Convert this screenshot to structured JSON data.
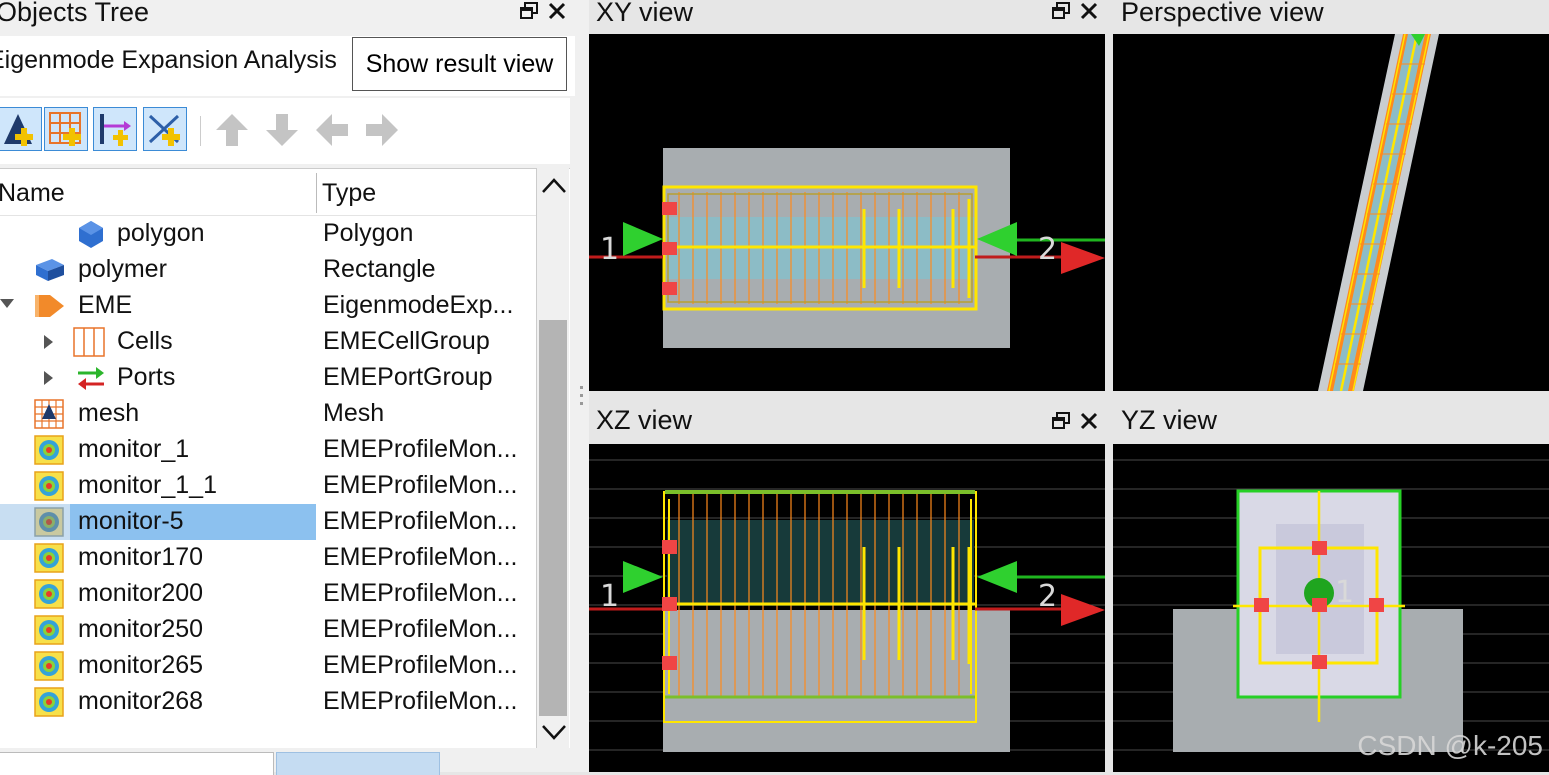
{
  "left_panel": {
    "title": "Objects Tree",
    "analysis_label": "Eigenmode Expansion Analysis",
    "show_result_button": "Show result view",
    "toolbar": {
      "buttons": [
        "add-structure-icon",
        "add-mesh-icon",
        "add-port-icon",
        "add-monitor-icon"
      ],
      "arrows": [
        "arrow-up-icon",
        "arrow-down-icon",
        "arrow-left-icon",
        "arrow-right-icon"
      ]
    },
    "columns": {
      "name": "Name",
      "type": "Type"
    },
    "rows": [
      {
        "name": "polygon",
        "type": "Polygon",
        "icon": "polygon-icon"
      },
      {
        "name": "polymer",
        "type": "Rectangle",
        "icon": "rectangle-icon"
      },
      {
        "name": "EME",
        "type": "EigenmodeExp...",
        "icon": "eme-solver-icon"
      },
      {
        "name": "Cells",
        "type": "EMECellGroup",
        "icon": "cells-icon"
      },
      {
        "name": "Ports",
        "type": "EMEPortGroup",
        "icon": "ports-icon"
      },
      {
        "name": "mesh",
        "type": "Mesh",
        "icon": "mesh-icon"
      },
      {
        "name": "monitor_1",
        "type": "EMEProfileMon...",
        "icon": "monitor-icon"
      },
      {
        "name": "monitor_1_1",
        "type": "EMEProfileMon...",
        "icon": "monitor-icon"
      },
      {
        "name": "monitor-5",
        "type": "EMEProfileMon...",
        "icon": "monitor-icon",
        "selected": true
      },
      {
        "name": "monitor170",
        "type": "EMEProfileMon...",
        "icon": "monitor-icon"
      },
      {
        "name": "monitor200",
        "type": "EMEProfileMon...",
        "icon": "monitor-icon"
      },
      {
        "name": "monitor250",
        "type": "EMEProfileMon...",
        "icon": "monitor-icon"
      },
      {
        "name": "monitor265",
        "type": "EMEProfileMon...",
        "icon": "monitor-icon"
      },
      {
        "name": "monitor268",
        "type": "EMEProfileMon...",
        "icon": "monitor-icon"
      }
    ]
  },
  "views": {
    "xy": {
      "title": "XY view",
      "port_labels": [
        "1",
        "2"
      ]
    },
    "perspective": {
      "title": "Perspective view"
    },
    "xz": {
      "title": "XZ view",
      "port_labels": [
        "1",
        "2"
      ]
    },
    "yz": {
      "title": "YZ view",
      "port_label": "1"
    }
  },
  "watermark": "CSDN @k-205",
  "colors": {
    "selection": "#8cc1ef",
    "structure": "#a9aeb0",
    "outline": "#ffe600",
    "cell_line": "#ff8a1c",
    "port_green": "#1fb51f",
    "port_red": "#d41c1c",
    "handle": "#f04545"
  }
}
